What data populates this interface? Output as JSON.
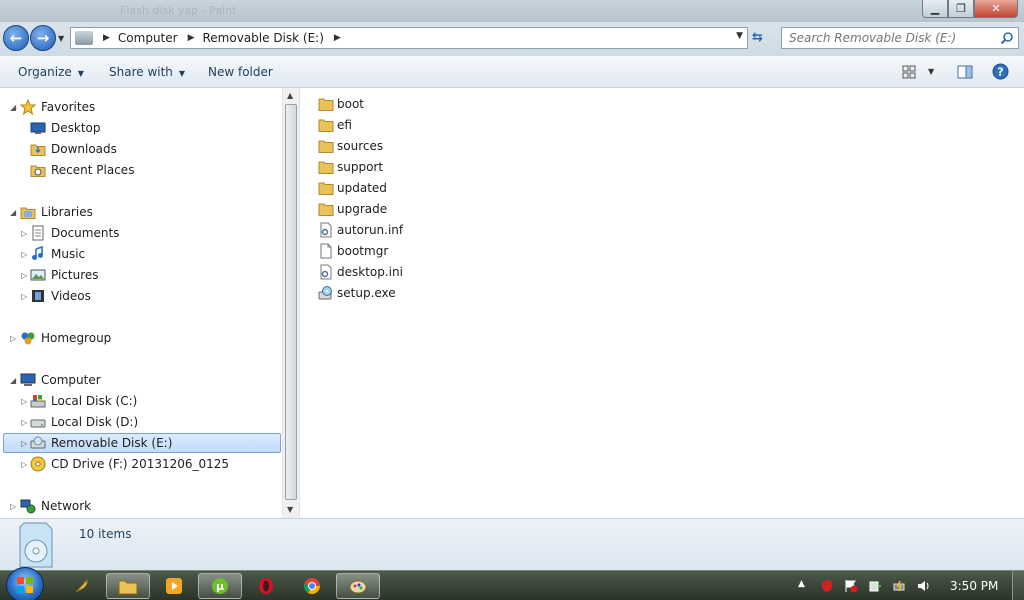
{
  "window": {
    "ghost_title": "Flash disk yap - Paint"
  },
  "address": {
    "crumbs": [
      "Computer",
      "Removable Disk (E:)"
    ]
  },
  "search": {
    "placeholder": "Search Removable Disk (E:)"
  },
  "toolbar": {
    "organize": "Organize",
    "share_with": "Share with",
    "new_folder": "New folder"
  },
  "nav": {
    "favorites": "Favorites",
    "desktop": "Desktop",
    "downloads": "Downloads",
    "recent_places": "Recent Places",
    "libraries": "Libraries",
    "documents": "Documents",
    "music": "Music",
    "pictures": "Pictures",
    "videos": "Videos",
    "homegroup": "Homegroup",
    "computer": "Computer",
    "local_c": "Local Disk (C:)",
    "local_d": "Local Disk (D:)",
    "removable_e": "Removable Disk (E:)",
    "cd_f": "CD Drive (F:) 20131206_0125",
    "network": "Network"
  },
  "files": [
    {
      "name": "boot",
      "type": "folder"
    },
    {
      "name": "efi",
      "type": "folder"
    },
    {
      "name": "sources",
      "type": "folder"
    },
    {
      "name": "support",
      "type": "folder"
    },
    {
      "name": "updated",
      "type": "folder"
    },
    {
      "name": "upgrade",
      "type": "folder"
    },
    {
      "name": "autorun.inf",
      "type": "settings"
    },
    {
      "name": "bootmgr",
      "type": "file"
    },
    {
      "name": "desktop.ini",
      "type": "settings"
    },
    {
      "name": "setup.exe",
      "type": "exe"
    }
  ],
  "details": {
    "count": "10 items"
  },
  "taskbar": {
    "clock": "3:50 PM"
  },
  "colors": {
    "folder": "#e8c35a",
    "selection": "#cfe3fc",
    "accent": "#1e3e5e"
  }
}
